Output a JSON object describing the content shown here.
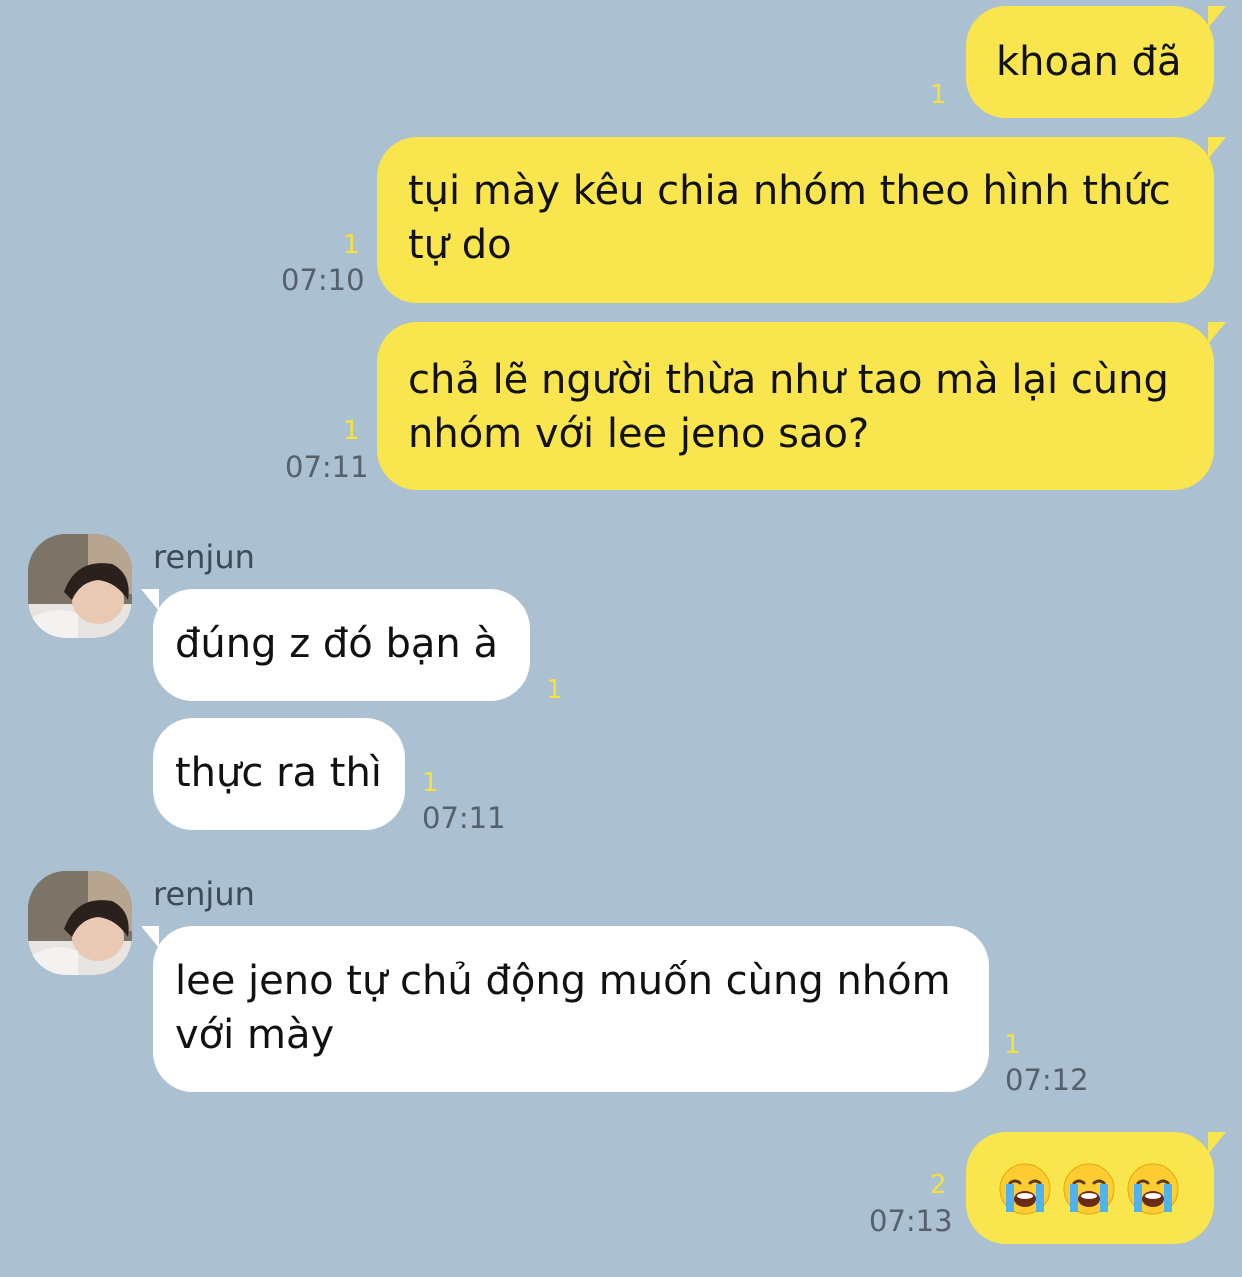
{
  "colors": {
    "background": "#abc1d1",
    "my_bubble": "#f9e54d",
    "their_bubble": "#ffffff",
    "unread_count": "#f5e23a",
    "timestamp": "#55606b"
  },
  "messages": [
    {
      "from": "me",
      "text": "khoan đã",
      "unread": "1",
      "time": ""
    },
    {
      "from": "me",
      "text": "tụi mày kêu chia nhóm theo hình thức\ntự do",
      "unread": "1",
      "time": "07:10"
    },
    {
      "from": "me",
      "text": "chả lẽ người thừa như tao mà lại cùng\nnhóm với lee jeno sao?",
      "unread": "1",
      "time": "07:11"
    },
    {
      "from": "them",
      "sender": "renjun",
      "text": "đúng z đó bạn à",
      "unread": "1",
      "time": ""
    },
    {
      "from": "them",
      "text": "thực ra thì",
      "unread": "1",
      "time": "07:11"
    },
    {
      "from": "them",
      "sender": "renjun",
      "text": "lee jeno tự chủ động muốn cùng nhóm\nvới mày",
      "unread": "1",
      "time": "07:12"
    },
    {
      "from": "me",
      "emojis": [
        "loudly-crying-face",
        "loudly-crying-face",
        "loudly-crying-face"
      ],
      "unread": "2",
      "time": "07:13"
    }
  ]
}
